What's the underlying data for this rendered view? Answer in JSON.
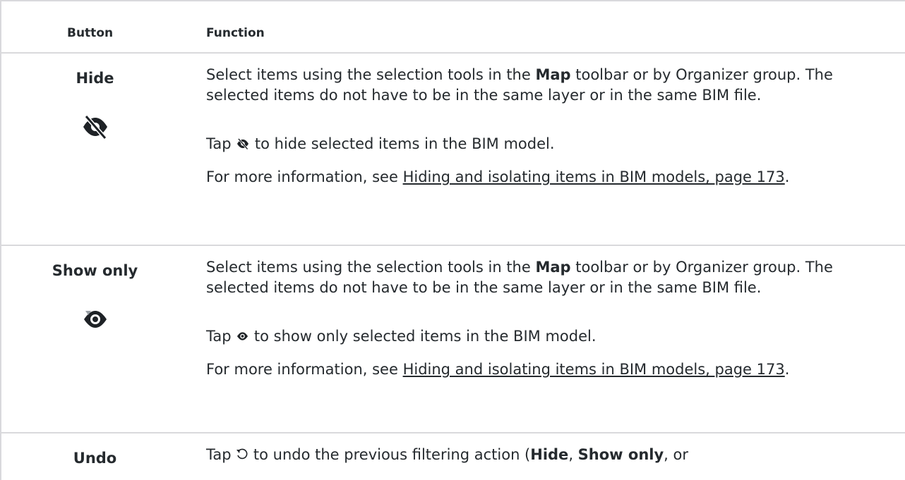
{
  "header": {
    "col_button": "Button",
    "col_function": "Function"
  },
  "rows": [
    {
      "button": "Hide",
      "icon": "eye-slash-icon",
      "p1": {
        "pre": "Select items using the selection tools in the ",
        "bold": "Map",
        "post": " toolbar or by Organizer group. The selected items do not have to be in the same layer or in the same BIM file."
      },
      "p2": {
        "pre": "Tap ",
        "icon": "eye-slash-icon",
        "post": " to hide selected items in the BIM model."
      },
      "p3": {
        "pre": "For more information, see ",
        "link": "Hiding and isolating items in BIM models, page 173",
        "post": "."
      }
    },
    {
      "button": "Show only",
      "icon": "eye-isolate-icon",
      "p1": {
        "pre": "Select items using the selection tools in the ",
        "bold": "Map",
        "post": " toolbar or by Organizer group. The selected items do not have to be in the same layer or in the same BIM file."
      },
      "p2": {
        "pre": "Tap ",
        "icon": "eye-isolate-icon",
        "post": " to show only selected items in the BIM model."
      },
      "p3": {
        "pre": "For more information, see ",
        "link": "Hiding and isolating items in BIM models, page 173",
        "post": "."
      }
    },
    {
      "button": "Undo",
      "icon": "undo-icon",
      "p1": {
        "pre": "Tap ",
        "icon": "undo-icon",
        "mid": " to undo the previous filtering action (",
        "bold1": "Hide",
        "sep": ", ",
        "bold2": "Show only",
        "post": ", or"
      }
    }
  ]
}
